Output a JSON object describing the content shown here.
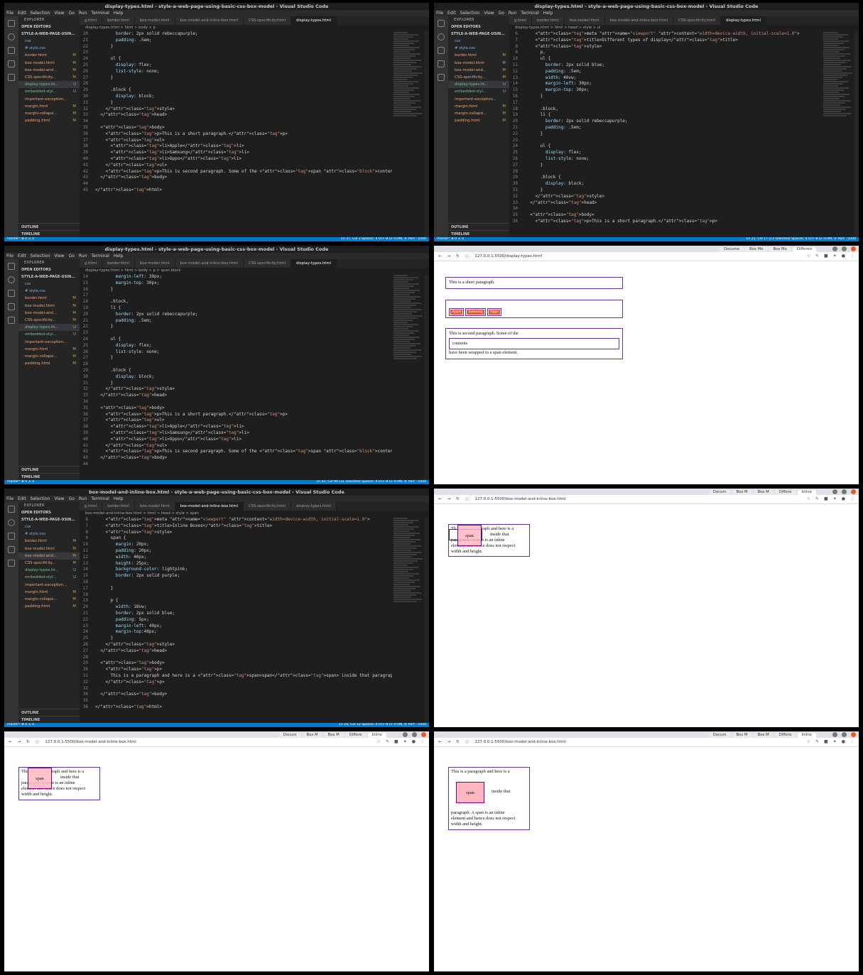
{
  "panels": {
    "p1": {
      "title": "display-types.html - style-a-web-page-using-basic-css-box-model - Visual Studio Code",
      "menu": [
        "File",
        "Edit",
        "Selection",
        "View",
        "Go",
        "Run",
        "Terminal",
        "Help"
      ],
      "explorer_header": "EXPLORER",
      "open_editors": "OPEN EDITORS",
      "project": "STYLE-A-WEB-PAGE-USIN...",
      "files": [
        {
          "name": "css",
          "status": ""
        },
        {
          "name": "# style.css",
          "status": ""
        },
        {
          "name": "border.html",
          "status": "M"
        },
        {
          "name": "box-model.html",
          "status": "M"
        },
        {
          "name": "box-model-and...",
          "status": "M"
        },
        {
          "name": "CSS-specificity...",
          "status": "M"
        },
        {
          "name": "display-types.ht...",
          "status": "U"
        },
        {
          "name": "embedded-styl...",
          "status": "U"
        },
        {
          "name": "important-exception...",
          "status": ""
        },
        {
          "name": "margin.html",
          "status": "M"
        },
        {
          "name": "margin-collapsi...",
          "status": "M"
        },
        {
          "name": "padding.html",
          "status": "M"
        }
      ],
      "outline": "OUTLINE",
      "timeline": "TIMELINE",
      "tabs": [
        "g.html",
        "border.html",
        "box-model.html",
        "box-model-and-inline-box.html",
        "CSS-specificity.html",
        "display-types.html"
      ],
      "crumbs": "display-types.html > html > body > p",
      "code": [
        [
          "20",
          "        border: 2px solid rebeccapurple;"
        ],
        [
          "21",
          "        padding: .5em;"
        ],
        [
          "22",
          "      }"
        ],
        [
          "23",
          ""
        ],
        [
          "24",
          "      ul {"
        ],
        [
          "25",
          "        display: flex;"
        ],
        [
          "26",
          "        list-style: none;"
        ],
        [
          "27",
          "      }"
        ],
        [
          "28",
          ""
        ],
        [
          "29",
          "      .block {"
        ],
        [
          "30",
          "        display: block;"
        ],
        [
          "31",
          "      }"
        ],
        [
          "32",
          "    </style>"
        ],
        [
          "33",
          "  </head>"
        ],
        [
          "34",
          ""
        ],
        [
          "35",
          "  <body>"
        ],
        [
          "36",
          "    <p>This is a short paragraph.</p>"
        ],
        [
          "37",
          "    <ul>"
        ],
        [
          "38",
          "      <li>Apple</li>"
        ],
        [
          "39",
          "      <li>Samsung</li>"
        ],
        [
          "40",
          "      <li>Oppo</li>"
        ],
        [
          "41",
          "    </ul>"
        ],
        [
          "42",
          "    <p>This is second paragraph. Some of the <span class=\"block\">contents</span> have been wrapped in a"
        ],
        [
          "43",
          "  </body>"
        ],
        [
          "44",
          ""
        ],
        [
          "45",
          "</html>"
        ]
      ],
      "status_left": "master*  ⊗ 0 ⚠ 0",
      "status_right": "Ln 37, Col 3   Spaces: 4   UTF-8   LF   HTML   ⦿ Port : 5500"
    },
    "p2": {
      "title": "display-types.html - style-a-web-page-using-basic-css-box-model - Visual Studio Code",
      "crumbs": "display-types.html > html > head > style > ul",
      "code": [
        [
          "6",
          "    <meta name=\"viewport\" content=\"width=device-width, initial-scale=1.0\">"
        ],
        [
          "7",
          "    <title>Different types of display</title>"
        ],
        [
          "8",
          "    <style>"
        ],
        [
          "9",
          "      p,"
        ],
        [
          "10",
          "      ul {"
        ],
        [
          "11",
          "        border: 2px solid blue;"
        ],
        [
          "12",
          "        padding: .5em;"
        ],
        [
          "13",
          "        width: 40vw;"
        ],
        [
          "14",
          "        margin-left: 30px;"
        ],
        [
          "15",
          "        margin-top: 30px;"
        ],
        [
          "16",
          "      }"
        ],
        [
          "17",
          ""
        ],
        [
          "18",
          "      .block,"
        ],
        [
          "19",
          "      li {"
        ],
        [
          "20",
          "        border: 2px solid rebeccapurple;"
        ],
        [
          "21",
          "        padding: .5em;"
        ],
        [
          "22",
          "      }"
        ],
        [
          "23",
          ""
        ],
        [
          "24",
          "      ul {"
        ],
        [
          "25",
          "        display: flex;"
        ],
        [
          "26",
          "        list-style: none;"
        ],
        [
          "27",
          "      }"
        ],
        [
          "28",
          ""
        ],
        [
          "29",
          "      .block {"
        ],
        [
          "30",
          "        display: block;"
        ],
        [
          "31",
          "      }"
        ],
        [
          "32",
          "    </style>"
        ],
        [
          "33",
          "  </head>"
        ],
        [
          "34",
          ""
        ],
        [
          "35",
          "  <body>"
        ],
        [
          "36",
          "    <p>This is a short paragraph.</p>"
        ]
      ],
      "status_right": "Ln 25, Col 17 (13 selected)   Spaces: 4   UTF-8   LF   HTML   ⦿ Port : 5500"
    },
    "p3": {
      "title": "display-types.html - style-a-web-page-using-basic-css-box-model - Visual Studio Code",
      "crumbs": "display-types.html > html > body > p > span.block",
      "code": [
        [
          "14",
          "        margin-left: 30px;"
        ],
        [
          "15",
          "        margin-top: 30px;"
        ],
        [
          "16",
          "      }"
        ],
        [
          "17",
          ""
        ],
        [
          "18",
          "      .block,"
        ],
        [
          "19",
          "      li {"
        ],
        [
          "20",
          "        border: 2px solid rebeccapurple;"
        ],
        [
          "21",
          "        padding: .5em;"
        ],
        [
          "22",
          "      }"
        ],
        [
          "23",
          ""
        ],
        [
          "24",
          "      ul {"
        ],
        [
          "25",
          "        display: flex;"
        ],
        [
          "26",
          "        list-style: none;"
        ],
        [
          "27",
          "      }"
        ],
        [
          "28",
          ""
        ],
        [
          "29",
          "      .block {"
        ],
        [
          "30",
          "        display: block;"
        ],
        [
          "31",
          "      }"
        ],
        [
          "32",
          "    </style>"
        ],
        [
          "33",
          "  </head>"
        ],
        [
          "34",
          ""
        ],
        [
          "35",
          "  <body>"
        ],
        [
          "36",
          "    <p>This is a short paragraph.</p>"
        ],
        [
          "37",
          "    <ul>"
        ],
        [
          "38",
          "      <li>Apple</li>"
        ],
        [
          "39",
          "      <li>Samsung</li>"
        ],
        [
          "40",
          "      <li>Oppo</li>"
        ],
        [
          "41",
          "    </ul>"
        ],
        [
          "42",
          "    <p>This is second paragraph. Some of the <span class=\"block\">contents</span> have been wrapped in a"
        ],
        [
          "43",
          "  </body>"
        ],
        [
          "44",
          ""
        ]
      ],
      "status_right": "Ln 42, Col 90 (31 selected)   Spaces: 4   UTF-8   LF   HTML   ⦿ Port : 5500"
    },
    "p4": {
      "tabs": [
        "Docume",
        "Box Mo",
        "Box Mo",
        "Differen"
      ],
      "url": "127.0.0.1:5500/display-types.html",
      "para1": "This is a short paragraph.",
      "items": [
        "Apple",
        "Samsung",
        "Oppo"
      ],
      "para2a": "This is second paragraph. Some of the",
      "para2b": "contents",
      "para2c": "have been wrapped in a span element."
    },
    "p5": {
      "title": "box-model-and-inline-box.html - style-a-web-page-using-basic-css-box-model - Visual Studio Code",
      "crumbs": "box-model-and-inline-box.html > html > head > style > span",
      "code": [
        [
          "6",
          "    <meta name=\"viewport\" content=\"width=device-width, initial-scale=1.0\">"
        ],
        [
          "7",
          "    <title>Inline Boxes</title>"
        ],
        [
          "8",
          "    <style>"
        ],
        [
          "9",
          "      span {"
        ],
        [
          "10",
          "        margin: 20px;"
        ],
        [
          "11",
          "        padding: 20px;"
        ],
        [
          "12",
          "        width: 40px;"
        ],
        [
          "13",
          "        height: 25px;"
        ],
        [
          "14",
          "        background-color: lightpink;"
        ],
        [
          "15",
          "        border: 2px solid purple;"
        ],
        [
          "16",
          ""
        ],
        [
          "17",
          "      }"
        ],
        [
          "18",
          ""
        ],
        [
          "19",
          "      p {"
        ],
        [
          "20",
          "        width: 18vw;"
        ],
        [
          "21",
          "        border: 2px solid blue;"
        ],
        [
          "22",
          "        padding: 5px;"
        ],
        [
          "23",
          "        margin-left: 40px;"
        ],
        [
          "24",
          "        margin-top:40px;"
        ],
        [
          "25",
          "      }"
        ],
        [
          "26",
          "    </style>"
        ],
        [
          "27",
          "  </head>"
        ],
        [
          "28",
          ""
        ],
        [
          "29",
          "  <body>"
        ],
        [
          "30",
          "    <p>"
        ],
        [
          "31",
          "      This is a paragraph and here is a <span>span</span> inside that paragraph. A span is an inline el"
        ],
        [
          "32",
          "    </p>"
        ],
        [
          "33",
          ""
        ],
        [
          "34",
          "  </body>"
        ],
        [
          "35",
          ""
        ],
        [
          "36",
          "</html>"
        ]
      ],
      "status_right": "Ln 16, Col 12   Spaces: 4   UTF-8   LF   HTML   ⦿ Port : 5500"
    },
    "p6": {
      "tabs": [
        "Docum",
        "Box M",
        "Box M",
        "Differe",
        "Inline"
      ],
      "url": "127.0.0.1:5500/box-model-and-inline-box.html",
      "text_a": "Th",
      "text_b": "raph and here is a",
      "span": "span",
      "text_c": "inside that",
      "text_d": "paragraph. A span is an inline",
      "text_e": "element and hence does not respect",
      "text_f": "width and height."
    },
    "p7": {
      "url": "127.0.0.1:5500/box-model-and-inline-box.html",
      "text_a": "Thi",
      "text_b": "raph and here is a",
      "span": "span",
      "text_c": "inside that",
      "text_d": "paragraph. A span is an inline",
      "text_e": "element and hence does not respect",
      "text_f": "width and height."
    },
    "p8": {
      "url": "127.0.0.1:5500/box-model-and-inline-box.html",
      "line1": "This is a paragraph and here is a",
      "span": "span",
      "inside": "inside that",
      "line2": "paragraph. A span is an inline",
      "line3": "element and hence does not respect",
      "line4": "width and height."
    }
  }
}
